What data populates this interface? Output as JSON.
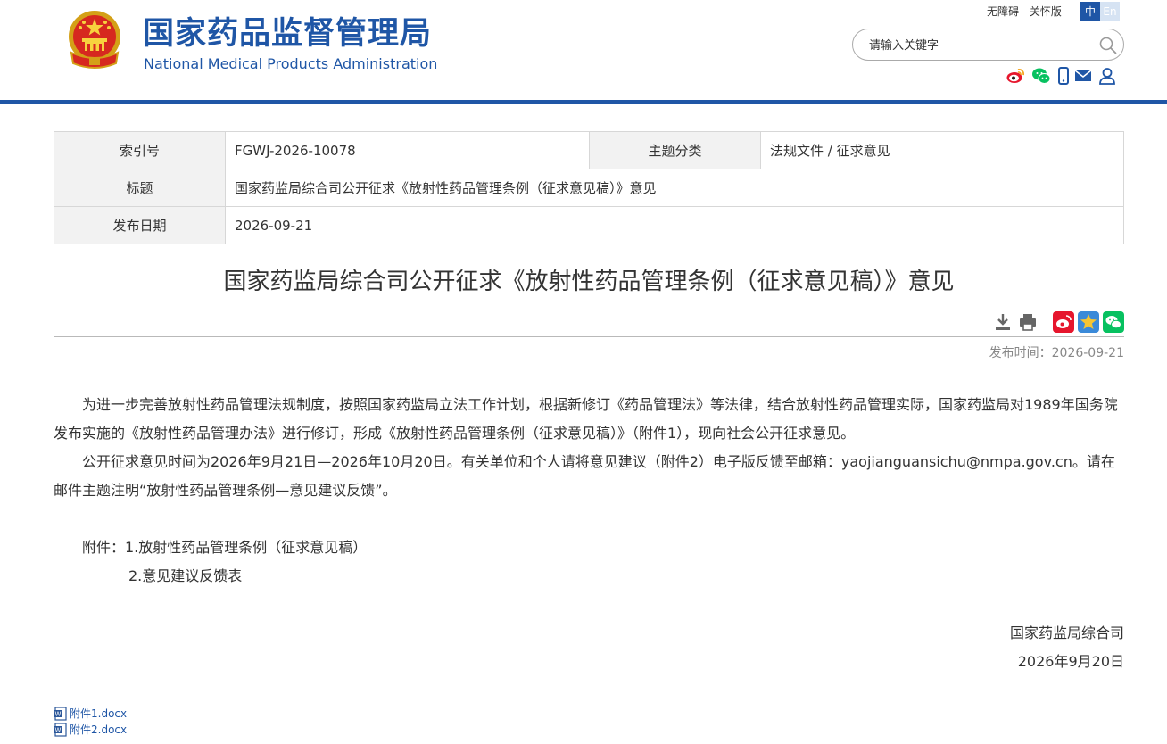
{
  "header": {
    "logo_cn": "国家药品监督管理局",
    "logo_en": "National Medical Products Administration",
    "accessibility": "无障碍",
    "elderly": "关怀版",
    "lang_zh": "中",
    "lang_en": "En",
    "search_placeholder": "请输入关键字",
    "social_icons": [
      "weibo-icon",
      "wechat-icon",
      "mobile-icon",
      "mail-icon",
      "user-icon"
    ]
  },
  "info_table": {
    "index_label": "索引号",
    "index_value": "FGWJ-2026-10078",
    "category_label": "主题分类",
    "category_value": "法规文件 / 征求意见",
    "title_label": "标题",
    "title_value": "国家药监局综合司公开征求《放射性药品管理条例（征求意见稿）》意见",
    "date_label": "发布日期",
    "date_value": "2026-09-21"
  },
  "article": {
    "title": "国家药监局综合司公开征求《放射性药品管理条例（征求意见稿）》意见",
    "publish_time": "发布时间：2026-09-21",
    "paragraph1": "为进一步完善放射性药品管理法规制度，按照国家药监局立法工作计划，根据新修订《药品管理法》等法律，结合放射性药品管理实际，国家药监局对1989年国务院发布实施的《放射性药品管理办法》进行修订，形成《放射性药品管理条例（征求意见稿）》（附件1），现向社会公开征求意见。",
    "paragraph2": "公开征求意见时间为2026年9月21日—2026年10月20日。有关单位和个人请将意见建议（附件2）电子版反馈至邮箱：yaojianguansichu@nmpa.gov.cn。请在邮件主题注明“放射性药品管理条例—意见建议反馈”。",
    "attachment1": "附件：1.放射性药品管理条例（征求意见稿）",
    "attachment2": "2.意见建议反馈表",
    "signature": "国家药监局综合司",
    "sign_date": "2026年9月20日"
  },
  "files": [
    "附件1.docx",
    "附件2.docx"
  ],
  "colors": {
    "brand": "#1f56a6",
    "label_bg": "#f2f2f2",
    "border": "#d7d7d7",
    "weibo": "#e6162d",
    "wechat": "#07c160",
    "favorite": "#f5a623"
  }
}
